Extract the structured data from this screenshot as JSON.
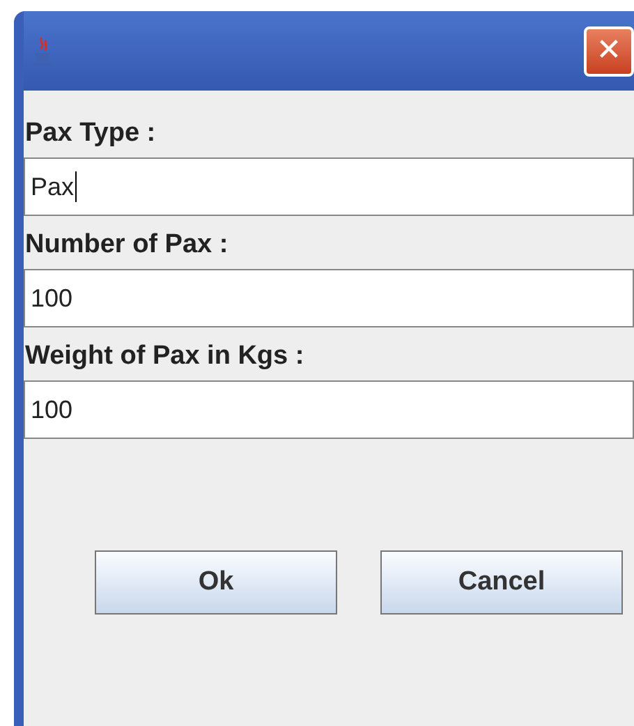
{
  "window": {
    "close_label": "✕"
  },
  "fields": [
    {
      "label": "Pax Type :",
      "value": "Pax",
      "focused": true
    },
    {
      "label": "Number of Pax :",
      "value": "100",
      "focused": false
    },
    {
      "label": "Weight of Pax in Kgs :",
      "value": "100",
      "focused": false
    }
  ],
  "buttons": [
    "Ok",
    "Cancel"
  ]
}
